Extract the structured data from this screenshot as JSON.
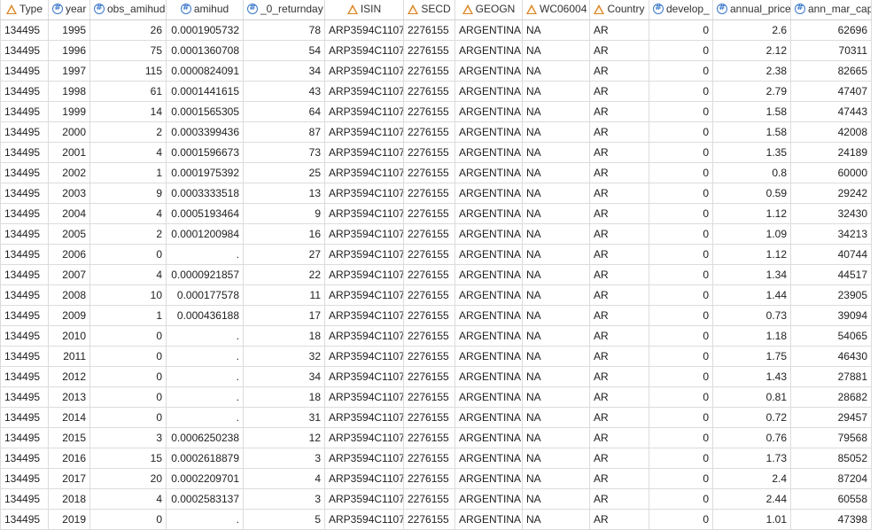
{
  "columns": [
    {
      "name": "Type",
      "type": "char",
      "align": "chr"
    },
    {
      "name": "year",
      "type": "num",
      "align": "num"
    },
    {
      "name": "obs_amihud",
      "type": "num",
      "align": "num"
    },
    {
      "name": "amihud",
      "type": "num",
      "align": "num"
    },
    {
      "name": "_0_returnday",
      "type": "num",
      "align": "num"
    },
    {
      "name": "ISIN",
      "type": "char",
      "align": "chr"
    },
    {
      "name": "SECD",
      "type": "char",
      "align": "chr"
    },
    {
      "name": "GEOGN",
      "type": "char",
      "align": "chr"
    },
    {
      "name": "WC06004",
      "type": "char",
      "align": "chr"
    },
    {
      "name": "Country",
      "type": "char",
      "align": "chr"
    },
    {
      "name": "develop_",
      "type": "num",
      "align": "num"
    },
    {
      "name": "annual_price",
      "type": "num",
      "align": "num"
    },
    {
      "name": "ann_mar_cap",
      "type": "num",
      "align": "num"
    }
  ],
  "rows": [
    [
      "134495",
      "1995",
      "26",
      "0.0001905732",
      "78",
      "ARP3594C1107",
      "2276155",
      "ARGENTINA",
      "NA",
      "AR",
      "0",
      "2.6",
      "62696"
    ],
    [
      "134495",
      "1996",
      "75",
      "0.0001360708",
      "54",
      "ARP3594C1107",
      "2276155",
      "ARGENTINA",
      "NA",
      "AR",
      "0",
      "2.12",
      "70311"
    ],
    [
      "134495",
      "1997",
      "115",
      "0.0000824091",
      "34",
      "ARP3594C1107",
      "2276155",
      "ARGENTINA",
      "NA",
      "AR",
      "0",
      "2.38",
      "82665"
    ],
    [
      "134495",
      "1998",
      "61",
      "0.0001441615",
      "43",
      "ARP3594C1107",
      "2276155",
      "ARGENTINA",
      "NA",
      "AR",
      "0",
      "2.79",
      "47407"
    ],
    [
      "134495",
      "1999",
      "14",
      "0.0001565305",
      "64",
      "ARP3594C1107",
      "2276155",
      "ARGENTINA",
      "NA",
      "AR",
      "0",
      "1.58",
      "47443"
    ],
    [
      "134495",
      "2000",
      "2",
      "0.0003399436",
      "87",
      "ARP3594C1107",
      "2276155",
      "ARGENTINA",
      "NA",
      "AR",
      "0",
      "1.58",
      "42008"
    ],
    [
      "134495",
      "2001",
      "4",
      "0.0001596673",
      "73",
      "ARP3594C1107",
      "2276155",
      "ARGENTINA",
      "NA",
      "AR",
      "0",
      "1.35",
      "24189"
    ],
    [
      "134495",
      "2002",
      "1",
      "0.0001975392",
      "25",
      "ARP3594C1107",
      "2276155",
      "ARGENTINA",
      "NA",
      "AR",
      "0",
      "0.8",
      "60000"
    ],
    [
      "134495",
      "2003",
      "9",
      "0.0003333518",
      "13",
      "ARP3594C1107",
      "2276155",
      "ARGENTINA",
      "NA",
      "AR",
      "0",
      "0.59",
      "29242"
    ],
    [
      "134495",
      "2004",
      "4",
      "0.0005193464",
      "9",
      "ARP3594C1107",
      "2276155",
      "ARGENTINA",
      "NA",
      "AR",
      "0",
      "1.12",
      "32430"
    ],
    [
      "134495",
      "2005",
      "2",
      "0.0001200984",
      "16",
      "ARP3594C1107",
      "2276155",
      "ARGENTINA",
      "NA",
      "AR",
      "0",
      "1.09",
      "34213"
    ],
    [
      "134495",
      "2006",
      "0",
      ".",
      "27",
      "ARP3594C1107",
      "2276155",
      "ARGENTINA",
      "NA",
      "AR",
      "0",
      "1.12",
      "40744"
    ],
    [
      "134495",
      "2007",
      "4",
      "0.0000921857",
      "22",
      "ARP3594C1107",
      "2276155",
      "ARGENTINA",
      "NA",
      "AR",
      "0",
      "1.34",
      "44517"
    ],
    [
      "134495",
      "2008",
      "10",
      "0.000177578",
      "11",
      "ARP3594C1107",
      "2276155",
      "ARGENTINA",
      "NA",
      "AR",
      "0",
      "1.44",
      "23905"
    ],
    [
      "134495",
      "2009",
      "1",
      "0.000436188",
      "17",
      "ARP3594C1107",
      "2276155",
      "ARGENTINA",
      "NA",
      "AR",
      "0",
      "0.73",
      "39094"
    ],
    [
      "134495",
      "2010",
      "0",
      ".",
      "18",
      "ARP3594C1107",
      "2276155",
      "ARGENTINA",
      "NA",
      "AR",
      "0",
      "1.18",
      "54065"
    ],
    [
      "134495",
      "2011",
      "0",
      ".",
      "32",
      "ARP3594C1107",
      "2276155",
      "ARGENTINA",
      "NA",
      "AR",
      "0",
      "1.75",
      "46430"
    ],
    [
      "134495",
      "2012",
      "0",
      ".",
      "34",
      "ARP3594C1107",
      "2276155",
      "ARGENTINA",
      "NA",
      "AR",
      "0",
      "1.43",
      "27881"
    ],
    [
      "134495",
      "2013",
      "0",
      ".",
      "18",
      "ARP3594C1107",
      "2276155",
      "ARGENTINA",
      "NA",
      "AR",
      "0",
      "0.81",
      "28682"
    ],
    [
      "134495",
      "2014",
      "0",
      ".",
      "31",
      "ARP3594C1107",
      "2276155",
      "ARGENTINA",
      "NA",
      "AR",
      "0",
      "0.72",
      "29457"
    ],
    [
      "134495",
      "2015",
      "3",
      "0.0006250238",
      "12",
      "ARP3594C1107",
      "2276155",
      "ARGENTINA",
      "NA",
      "AR",
      "0",
      "0.76",
      "79568"
    ],
    [
      "134495",
      "2016",
      "15",
      "0.0002618879",
      "3",
      "ARP3594C1107",
      "2276155",
      "ARGENTINA",
      "NA",
      "AR",
      "0",
      "1.73",
      "85052"
    ],
    [
      "134495",
      "2017",
      "20",
      "0.0002209701",
      "4",
      "ARP3594C1107",
      "2276155",
      "ARGENTINA",
      "NA",
      "AR",
      "0",
      "2.4",
      "87204"
    ],
    [
      "134495",
      "2018",
      "4",
      "0.0002583137",
      "3",
      "ARP3594C1107",
      "2276155",
      "ARGENTINA",
      "NA",
      "AR",
      "0",
      "2.44",
      "60558"
    ],
    [
      "134495",
      "2019",
      "0",
      ".",
      "5",
      "ARP3594C1107",
      "2276155",
      "ARGENTINA",
      "NA",
      "AR",
      "0",
      "1.01",
      "47398"
    ]
  ]
}
